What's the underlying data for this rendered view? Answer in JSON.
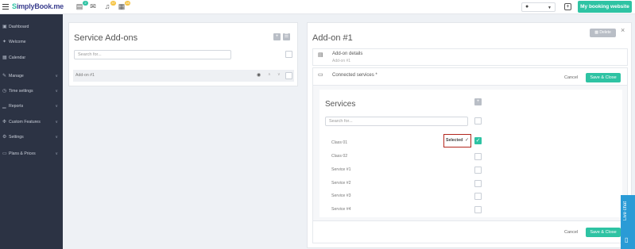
{
  "topbar": {
    "logo_prefix": "S",
    "logo_rest": "implyBook.me",
    "badges": [
      "2",
      "37",
      "28"
    ],
    "user_label": "●",
    "booking_website_label": "My booking website"
  },
  "sidebar": {
    "items": [
      {
        "label": "Dashboard",
        "icon": "dashboard-icon",
        "glyph": "▣"
      },
      {
        "label": "Welcome",
        "icon": "bulb-icon",
        "glyph": "✦"
      },
      {
        "label": "Calendar",
        "icon": "calendar-icon",
        "glyph": "▦"
      },
      {
        "label": "Manage",
        "icon": "pencil-icon",
        "glyph": "✎",
        "has_submenu": true
      },
      {
        "label": "Time settings",
        "icon": "clock-icon",
        "glyph": "◷",
        "has_submenu": true
      },
      {
        "label": "Reports",
        "icon": "bar-chart-icon",
        "glyph": "▁",
        "has_submenu": true
      },
      {
        "label": "Custom Features",
        "icon": "puzzle-icon",
        "glyph": "❉",
        "has_submenu": true
      },
      {
        "label": "Settings",
        "icon": "gears-icon",
        "glyph": "⚙",
        "has_submenu": true
      },
      {
        "label": "Plans & Prices",
        "icon": "money-icon",
        "glyph": "▭",
        "has_submenu": true
      }
    ]
  },
  "left_panel": {
    "title": "Service Add-ons",
    "search_placeholder": "Search for...",
    "rows": [
      {
        "label": "Add-on #1"
      }
    ]
  },
  "right_panel": {
    "title": "Add-on #1",
    "delete_label": "Delete",
    "addon_details": {
      "title": "Add-on details",
      "subtitle": "Add-on #1"
    },
    "connected_services": {
      "title": "Connected services *",
      "cancel_label": "Cancel",
      "save_label": "Save & Close"
    },
    "services": {
      "title": "Services",
      "search_placeholder": "Search for...",
      "selected_label": "Selected",
      "items": [
        {
          "label": "Class 01",
          "checked": true
        },
        {
          "label": "Class 02",
          "checked": false
        },
        {
          "label": "Service #1",
          "checked": false
        },
        {
          "label": "Service #2",
          "checked": false
        },
        {
          "label": "Service #3",
          "checked": false
        },
        {
          "label": "Service #4",
          "checked": false
        }
      ]
    },
    "footer": {
      "cancel_label": "Cancel",
      "save_label": "Save & Close"
    }
  },
  "live_chat": {
    "label": "Live chat"
  },
  "colors": {
    "accent": "#2ec3a3",
    "sidebar_bg": "#2c3344",
    "highlight_border": "#b3261e"
  }
}
